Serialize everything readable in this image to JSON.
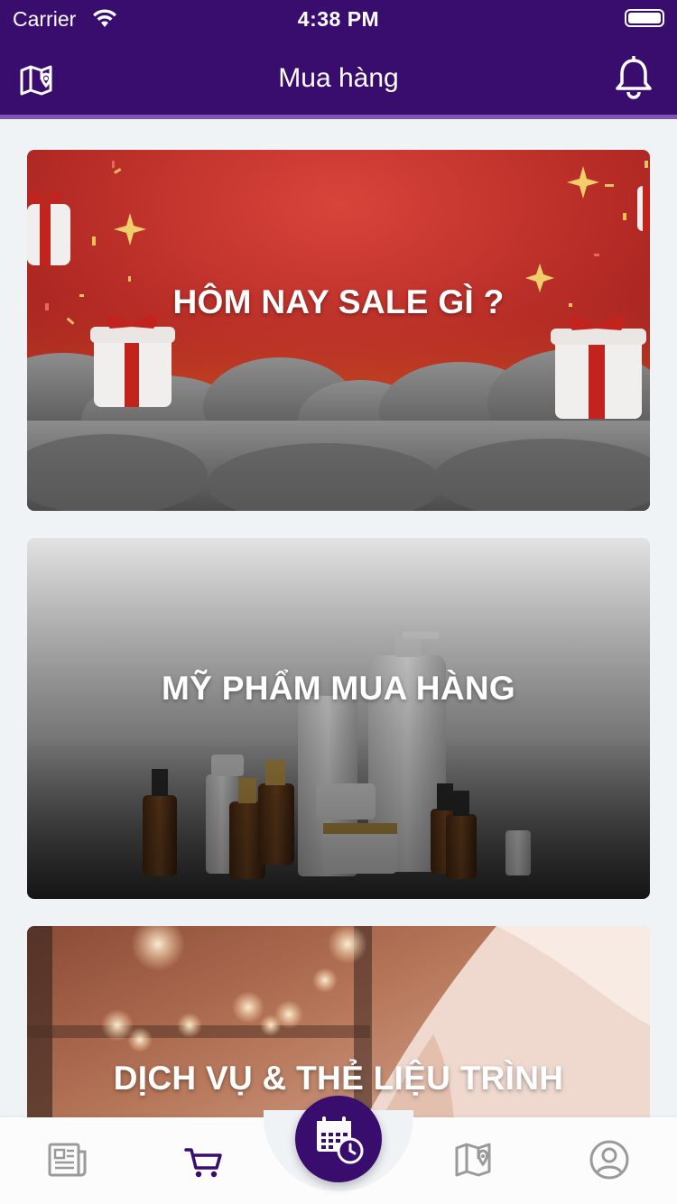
{
  "status_bar": {
    "carrier": "Carrier",
    "time": "4:38 PM",
    "icons": [
      "wifi-icon",
      "battery-icon"
    ]
  },
  "header": {
    "title": "Mua hàng",
    "left_icon": "map-pin-icon",
    "right_icon": "bell-icon"
  },
  "cards": [
    {
      "label": "HÔM NAY SALE GÌ ?",
      "image": "gifts-confetti-clouds"
    },
    {
      "label": "MỸ PHẨM MUA HÀNG",
      "image": "cosmetic-bottles"
    },
    {
      "label": "DỊCH VỤ & THẺ LIỆU TRÌNH",
      "image": "spa-massage"
    }
  ],
  "tab_bar": {
    "items": [
      {
        "icon": "newspaper-icon",
        "active": false
      },
      {
        "icon": "cart-icon",
        "active": true
      },
      {
        "icon": "calendar-clock-icon",
        "active": false,
        "center": true
      },
      {
        "icon": "map-icon",
        "active": false
      },
      {
        "icon": "user-circle-icon",
        "active": false
      }
    ]
  },
  "colors": {
    "primary": "#390d6e",
    "nav_border": "#7a56b0",
    "background": "#f0f3f6",
    "inactive_icon": "#9a9a9a"
  }
}
